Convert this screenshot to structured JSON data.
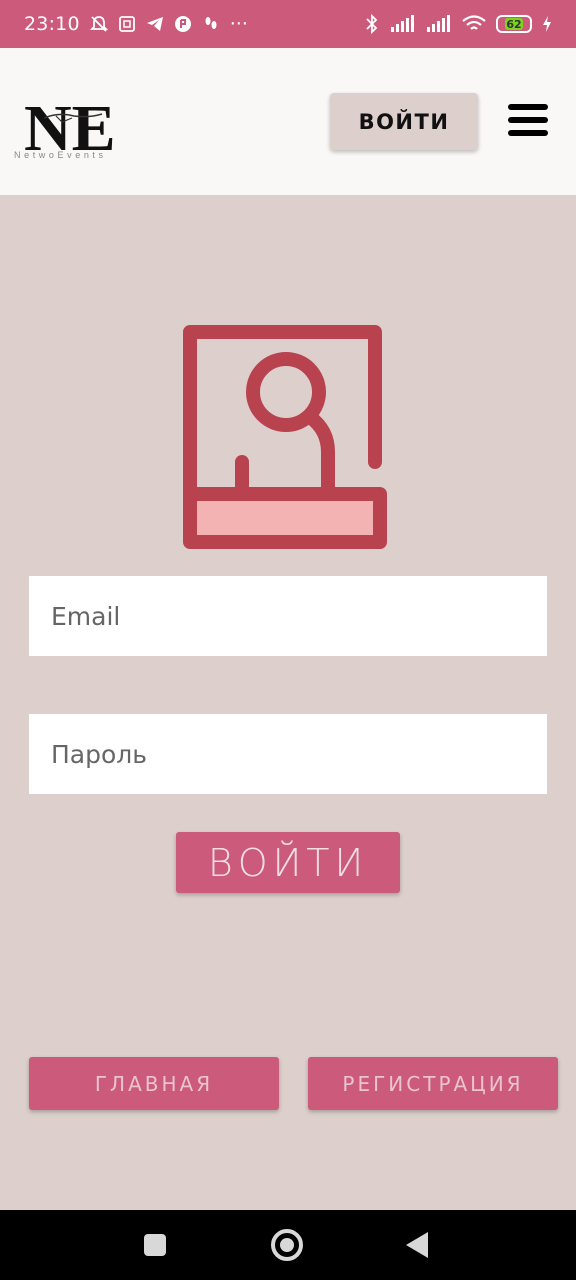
{
  "status_bar": {
    "time": "23:10",
    "notification_icons": [
      "mute-bell-icon",
      "sim-icon",
      "telegram-icon",
      "app-icon",
      "footsteps-icon"
    ],
    "more": "···",
    "battery": "62",
    "colors": {
      "background": "#cc5a7a",
      "battery_fill": "#7ed321"
    }
  },
  "header": {
    "logo_text": "NE",
    "logo_subtitle": "NetwoEvents",
    "login_label": "ВОЙТИ",
    "menu_icon": "hamburger-menu-icon"
  },
  "login_form": {
    "email_placeholder": "Email",
    "password_placeholder": "Пароль",
    "submit_label": "ВОЙТИ"
  },
  "footer_nav": {
    "home_label": "ГЛАВНАЯ",
    "register_label": "РЕГИСТРАЦИЯ"
  },
  "colors": {
    "page_background": "#ddd0cc",
    "accent": "#cc5a7a",
    "illustration_stroke": "#b8434f",
    "illustration_fill": "#f4b3b3"
  }
}
